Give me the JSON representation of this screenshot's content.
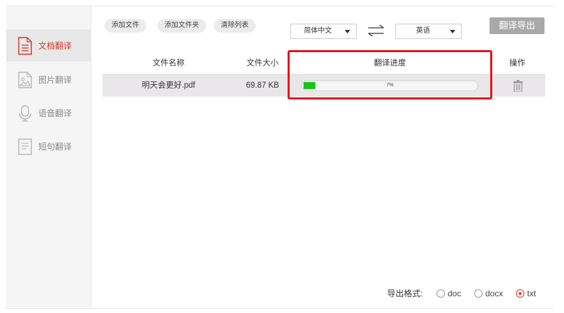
{
  "sidebar": {
    "items": [
      {
        "label": "文档翻译",
        "icon": "document-icon",
        "active": true
      },
      {
        "label": "图片翻译",
        "icon": "image-icon",
        "active": false
      },
      {
        "label": "语音翻译",
        "icon": "microphone-icon",
        "active": false
      },
      {
        "label": "短句翻译",
        "icon": "text-note-icon",
        "active": false
      }
    ]
  },
  "toolbar": {
    "add_file": "添加文件",
    "add_folder": "添加文件夹",
    "clear_list": "清除列表",
    "source_lang": "简体中文",
    "target_lang": "英语",
    "export_button": "翻译导出"
  },
  "table": {
    "headers": [
      "文件名称",
      "文件大小",
      "翻译进度",
      "操作"
    ],
    "rows": [
      {
        "name": "明天会更好.pdf",
        "size": "69.87 KB",
        "progress_text": "7%",
        "progress": 0.07
      }
    ]
  },
  "export_format": {
    "label": "导出格式:",
    "options": [
      "doc",
      "docx",
      "txt"
    ],
    "selected": "txt"
  },
  "colors": {
    "accent": "#d9362b",
    "progress": "#1cc21c",
    "highlight": "#e3151b"
  }
}
